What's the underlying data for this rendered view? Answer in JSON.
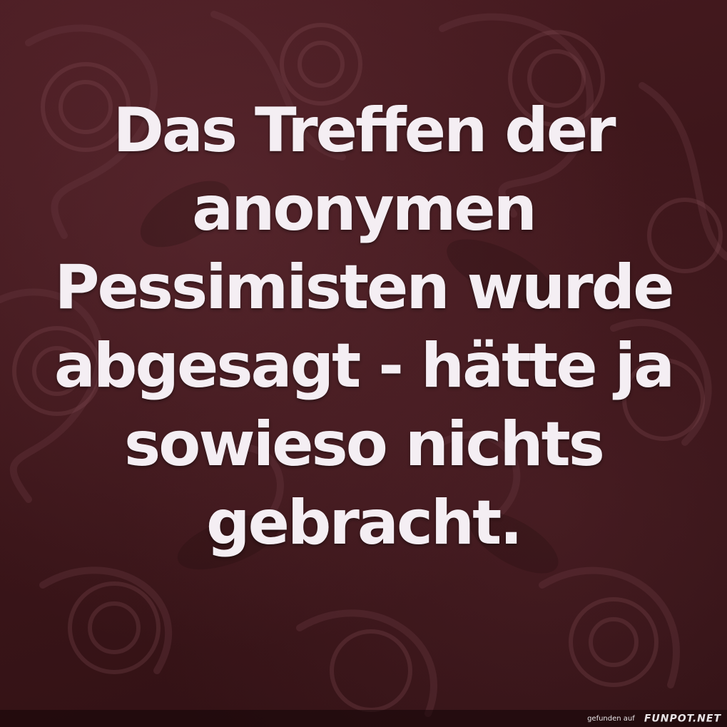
{
  "quote": {
    "lines": [
      "Das Treffen der",
      "anonymen",
      "Pessimisten wurde",
      "abgesagt - hätte ja",
      "sowieso nichts",
      "gebracht."
    ]
  },
  "watermark": {
    "prefix": "gefunden auf",
    "brand": "FUNPOT.NET"
  },
  "colors": {
    "background": "#3b1519",
    "text": "#f4eef3"
  }
}
